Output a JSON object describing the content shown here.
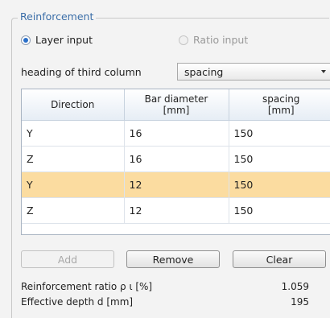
{
  "group": {
    "title": "Reinforcement"
  },
  "input_mode": {
    "layer_label": "Layer input",
    "ratio_label": "Ratio input"
  },
  "heading_select": {
    "label": "heading of third column",
    "value": "spacing"
  },
  "table": {
    "headers": {
      "direction": "Direction",
      "bar_diameter_line1": "Bar diameter",
      "bar_diameter_line2": "[mm]",
      "spacing_line1": "spacing",
      "spacing_line2": "[mm]"
    },
    "rows": [
      {
        "direction": "Y",
        "bar_diameter": "16",
        "spacing": "150"
      },
      {
        "direction": "Z",
        "bar_diameter": "16",
        "spacing": "150"
      },
      {
        "direction": "Y",
        "bar_diameter": "12",
        "spacing": "150"
      },
      {
        "direction": "Z",
        "bar_diameter": "12",
        "spacing": "150"
      }
    ],
    "selected_row": 2
  },
  "buttons": {
    "add": "Add",
    "remove": "Remove",
    "clear": "Clear"
  },
  "results": {
    "ratio_label": "Reinforcement ratio ρ ι [%]",
    "ratio_value": "1.059",
    "depth_label": "Effective depth d  [mm]",
    "depth_value": "195"
  },
  "colors": {
    "title": "#3b6ea8",
    "selected_row": "#fbdca0",
    "radio_checked": "#2a6fc9"
  }
}
